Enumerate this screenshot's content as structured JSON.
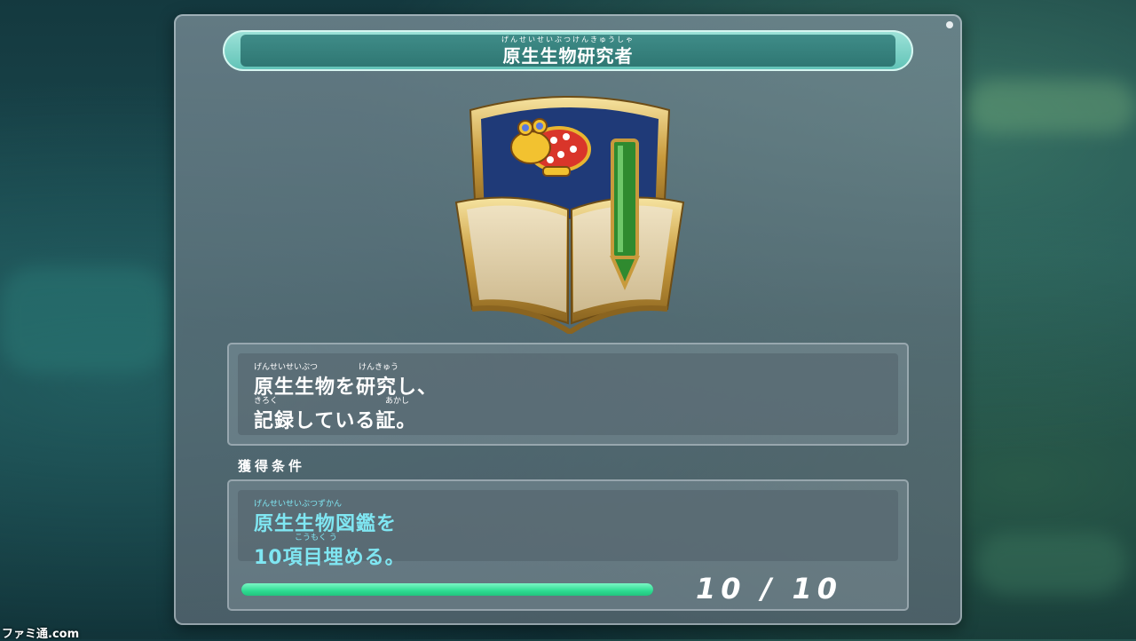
{
  "title": {
    "ruby": "げんせいせいぶつけんきゅうしゃ",
    "text": "原生生物研究者"
  },
  "description": {
    "line1_ruby_a": "げんせいせいぶつ",
    "line1_ruby_b": "けんきゅう",
    "line1": "原生生物を研究し、",
    "line2_ruby_a": "きろく",
    "line2_ruby_b": "あかし",
    "line2": "記録している証。"
  },
  "condition": {
    "label": "獲得条件",
    "line1_ruby": "げんせいせいぶつずかん",
    "line1": "原生生物図鑑を",
    "line2_ruby": "こうもく う",
    "line2": "10項目埋める。"
  },
  "progress": {
    "current_text": "10",
    "separator": "/",
    "total_text": "10",
    "fraction": 1.0,
    "counter": "10 / 10"
  },
  "watermark": "ファミ通.com",
  "colors": {
    "title_accent": "#5fc2b6",
    "condition_text": "#7fe6f2",
    "progress_fill": "#2fdc92"
  }
}
